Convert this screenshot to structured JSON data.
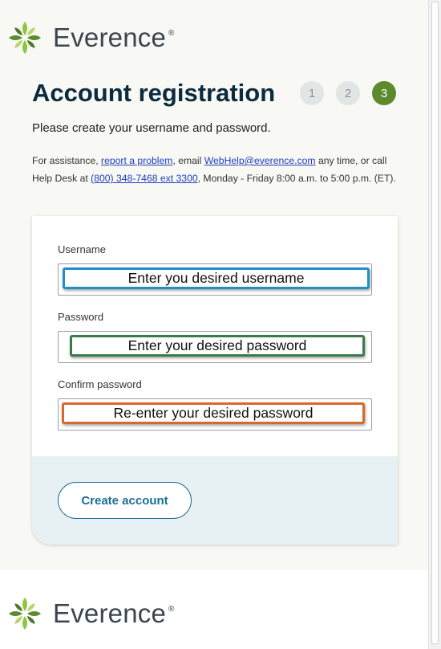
{
  "brand": {
    "name": "Everence",
    "registered": "®"
  },
  "header": {
    "title": "Account registration"
  },
  "steps": [
    "1",
    "2",
    "3"
  ],
  "subtitle": "Please create your username and password.",
  "assistance": {
    "prefix": "For assistance, ",
    "report_link": "report a problem",
    "email_prefix": ", email ",
    "email": "WebHelp@everence.com",
    "mid": " any time, or call Help Desk at ",
    "phone": "(800) 348-7468 ext 3300",
    "suffix": ", Monday - Friday 8:00 a.m. to 5:00 p.m. (ET)."
  },
  "form": {
    "username": {
      "label": "Username",
      "hint": "Enter you desired username",
      "value": ""
    },
    "password": {
      "label": "Password",
      "hint": "Enter your desired password",
      "value": ""
    },
    "confirm": {
      "label": "Confirm password",
      "hint": "Re-enter your desired password",
      "value": ""
    },
    "submit_label": "Create account"
  },
  "colors": {
    "brand_green": "#5e8a2e",
    "title_navy": "#0d2b3e",
    "link_blue": "#1f3fbf",
    "button_teal": "#1b6e94",
    "hint_blue": "#1e8fc8",
    "hint_green": "#3d7a4a",
    "hint_orange": "#d8692a"
  },
  "icons": {
    "logo": "everence-leaf-logo-icon"
  }
}
